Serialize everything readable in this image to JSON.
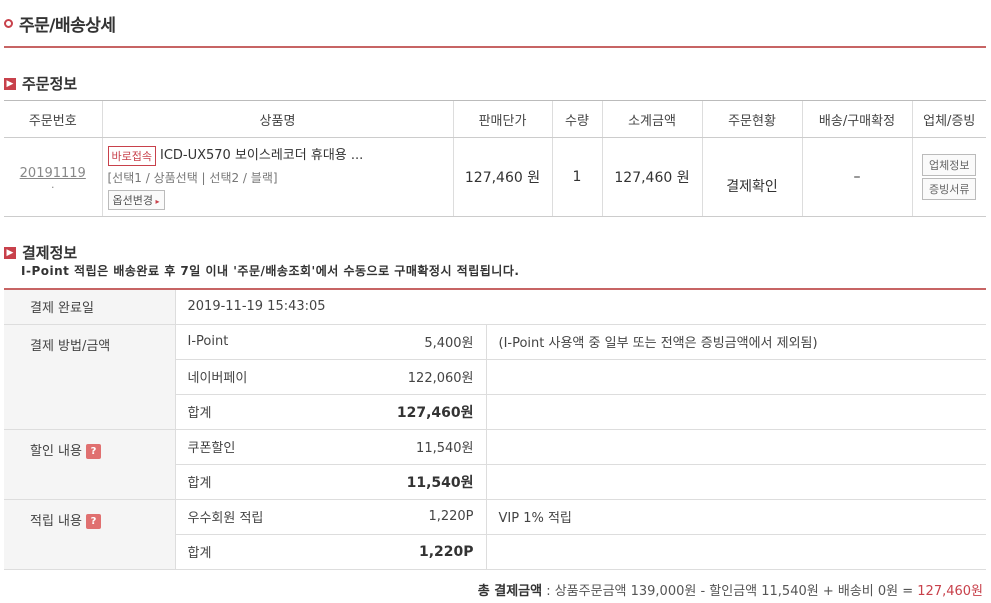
{
  "header": {
    "title": "주문/배송상세"
  },
  "order_section": {
    "title": "주문정보",
    "columns": [
      "주문번호",
      "상품명",
      "판매단가",
      "수량",
      "소계금액",
      "주문현황",
      "배송/구매확정",
      "업체/증빙"
    ],
    "row": {
      "order_no": "20191119",
      "dot": ".",
      "badge": "바로접속",
      "product": "ICD-UX570 보이스레코더 휴대용 ...",
      "options": "[선택1 / 상품선택 | 선택2 / 블랙]",
      "option_button": "옵션변경",
      "price": "127,460 원",
      "qty": "1",
      "subtotal": "127,460 원",
      "status": "결제확인",
      "delivery": "–",
      "vendor_button": "업체정보",
      "proof_button": "증빙서류"
    }
  },
  "payment_section": {
    "title": "결제정보",
    "notice": "I-Point 적립은 배송완료 후 7일 이내 '주문/배송조회'에서 수동으로 구매확정시 적립됩니다.",
    "complete_label": "결제 완료일",
    "complete_date": "2019-11-19 15:43:05",
    "method_label": "결제 방법/금액",
    "methods": [
      {
        "name": "I-Point",
        "amount": "5,400원",
        "note": "(I-Point 사용액 중 일부 또는 전액은 증빙금액에서 제외됨)"
      },
      {
        "name": "네이버페이",
        "amount": "122,060원",
        "note": ""
      },
      {
        "name": "합계",
        "amount": "127,460원",
        "note": ""
      }
    ],
    "discount_label": "할인 내용",
    "help": "?",
    "discounts": [
      {
        "name": "쿠폰할인",
        "amount": "11,540원",
        "note": ""
      },
      {
        "name": "합계",
        "amount": "11,540원",
        "note": ""
      }
    ],
    "reward_label": "적립 내용",
    "rewards": [
      {
        "name": "우수회원 적립",
        "amount": "1,220P",
        "note": "VIP 1% 적립"
      },
      {
        "name": "합계",
        "amount": "1,220P",
        "note": ""
      }
    ]
  },
  "total": {
    "label": "총 결제금액",
    "detail": " : 상품주문금액 139,000원 - 할인금액 11,540원 + 배송비 0원 = ",
    "amount": "127,460원"
  },
  "colors": {
    "accent": "#c8414b",
    "line": "#c76464"
  }
}
